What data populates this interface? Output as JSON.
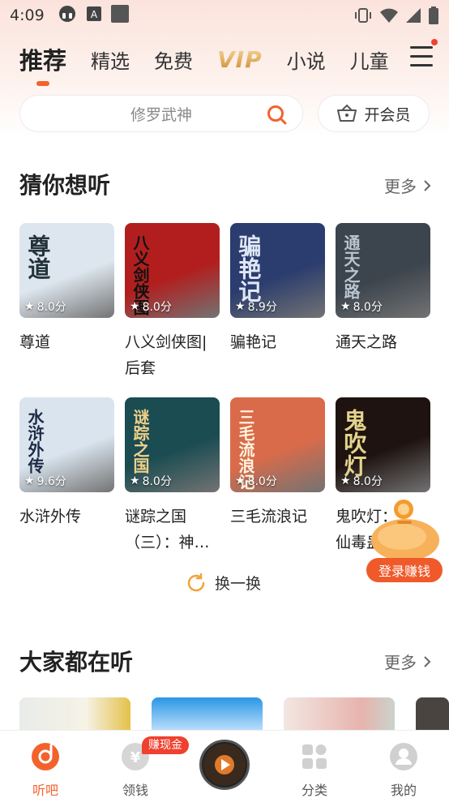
{
  "status_bar": {
    "time": "4:09"
  },
  "tabs": [
    {
      "label": "推荐",
      "active": true
    },
    {
      "label": "精选"
    },
    {
      "label": "免费"
    },
    {
      "label": "VIP"
    },
    {
      "label": "小说"
    },
    {
      "label": "儿童"
    }
  ],
  "search": {
    "placeholder": "修罗武神"
  },
  "vip_button": {
    "label": "开会员"
  },
  "section_guess": {
    "title": "猜你想听",
    "more": "更多",
    "books": [
      {
        "title": "尊道",
        "rating": "8.0分",
        "cover_text": "尊道",
        "cover_bg": "#dde6ee",
        "cover_fg": "#23323a"
      },
      {
        "title": "八义剑侠图|后套",
        "rating": "8.0分",
        "cover_text": "八义剑侠图",
        "cover_bg": "#b21e1e",
        "cover_fg": "#111111"
      },
      {
        "title": "骗艳记",
        "rating": "8.9分",
        "cover_text": "骗艳记",
        "cover_bg": "#2b3d6e",
        "cover_fg": "#dfe6f5"
      },
      {
        "title": "通天之路",
        "rating": "8.0分",
        "cover_text": "通天之路",
        "cover_bg": "#3c444d",
        "cover_fg": "#b9c4cf"
      },
      {
        "title": "水浒外传",
        "rating": "9.6分",
        "cover_text": "水浒外传",
        "cover_bg": "#d9e4ee",
        "cover_fg": "#1a2a44"
      },
      {
        "title": "谜踪之国（三）：神…",
        "rating": "8.0分",
        "cover_text": "谜踪之国",
        "cover_bg": "#1a4c52",
        "cover_fg": "#f0d08a"
      },
      {
        "title": "三毛流浪记",
        "rating": "8.0分",
        "cover_text": "三毛流浪记",
        "cover_bg": "#d96b4a",
        "cover_fg": "#fff3e0"
      },
      {
        "title": "鬼吹灯：杭州仙毒蛊",
        "rating": "8.0分",
        "cover_text": "鬼吹灯",
        "cover_bg": "#1e1310",
        "cover_fg": "#e4d38c"
      }
    ],
    "title_lines": [
      [
        "尊道"
      ],
      [
        "八义剑侠图|",
        "后套"
      ],
      [
        "骗艳记"
      ],
      [
        "通天之路"
      ],
      [
        "水浒外传"
      ],
      [
        "谜踪之国",
        "（三）：神…"
      ],
      [
        "三毛流浪记"
      ],
      [
        "鬼吹灯：",
        "仙毒蛊"
      ]
    ]
  },
  "swap": {
    "label": "换一换"
  },
  "section_popular": {
    "title": "大家都在听",
    "more": "更多"
  },
  "float_ad": {
    "label": "登录赚钱"
  },
  "bottom_nav": [
    {
      "label": "听吧",
      "active": true
    },
    {
      "label": "领钱",
      "badge": "赚现金"
    },
    {
      "label": ""
    },
    {
      "label": "分类"
    },
    {
      "label": "我的"
    }
  ],
  "colors": {
    "accent": "#f3622d",
    "badge": "#f0402e",
    "vip_gold": "#d9a24a"
  }
}
